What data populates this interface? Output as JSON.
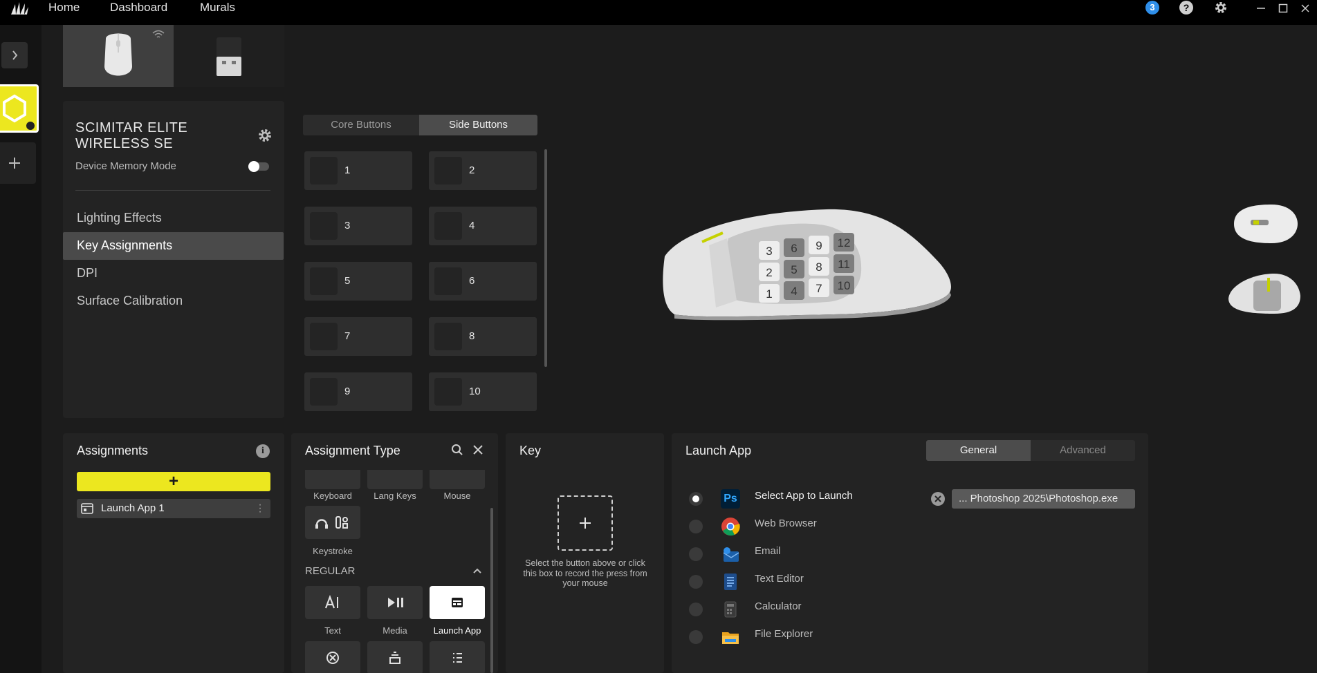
{
  "nav": {
    "home": "Home",
    "dashboard": "Dashboard",
    "murals": "Murals",
    "notification_count": "3"
  },
  "device": {
    "name_line1": "SCIMITAR ELITE",
    "name_line2": "WIRELESS SE",
    "memory_mode_label": "Device Memory Mode",
    "memory_mode_on": false,
    "menu": [
      "Lighting Effects",
      "Key Assignments",
      "DPI",
      "Surface Calibration"
    ],
    "active_menu": "Key Assignments"
  },
  "button_tabs": {
    "core": "Core Buttons",
    "side": "Side Buttons",
    "active": "Side Buttons"
  },
  "side_buttons": [
    "1",
    "2",
    "3",
    "4",
    "5",
    "6",
    "7",
    "8",
    "9",
    "10"
  ],
  "mouse_keypad": [
    "3",
    "6",
    "9",
    "12",
    "2",
    "5",
    "8",
    "11",
    "1",
    "4",
    "7",
    "10"
  ],
  "assignments": {
    "title": "Assignments",
    "add_label": "+",
    "items": [
      {
        "label": "Launch App 1"
      }
    ]
  },
  "assignment_type": {
    "title": "Assignment Type",
    "top_labels": [
      "Keyboard",
      "Lang Keys",
      "Mouse"
    ],
    "keystroke_label": "Keystroke",
    "section": "REGULAR",
    "regular": [
      "Text",
      "Media",
      "Launch App"
    ],
    "selected": "Launch App"
  },
  "key": {
    "title": "Key",
    "record_hint": "Select the button above or click this box to record the press from your mouse"
  },
  "launch_app": {
    "title": "Launch App",
    "tabs": [
      "General",
      "Advanced"
    ],
    "active_tab": "General",
    "options": [
      {
        "label": "Select App to Launch",
        "icon": "photoshop-icon",
        "selected": true
      },
      {
        "label": "Web Browser",
        "icon": "chrome-icon",
        "selected": false
      },
      {
        "label": "Email",
        "icon": "email-icon",
        "selected": false
      },
      {
        "label": "Text Editor",
        "icon": "text-editor-icon",
        "selected": false
      },
      {
        "label": "Calculator",
        "icon": "calculator-icon",
        "selected": false
      },
      {
        "label": "File Explorer",
        "icon": "folder-icon",
        "selected": false
      }
    ],
    "path_value": "... Photoshop 2025\\Photoshop.exe",
    "ps_icon_text": "Ps"
  },
  "colors": {
    "accent": "#ece71f",
    "bg": "#1a1a1a",
    "panel": "#232323",
    "badge": "#2f8fea"
  }
}
